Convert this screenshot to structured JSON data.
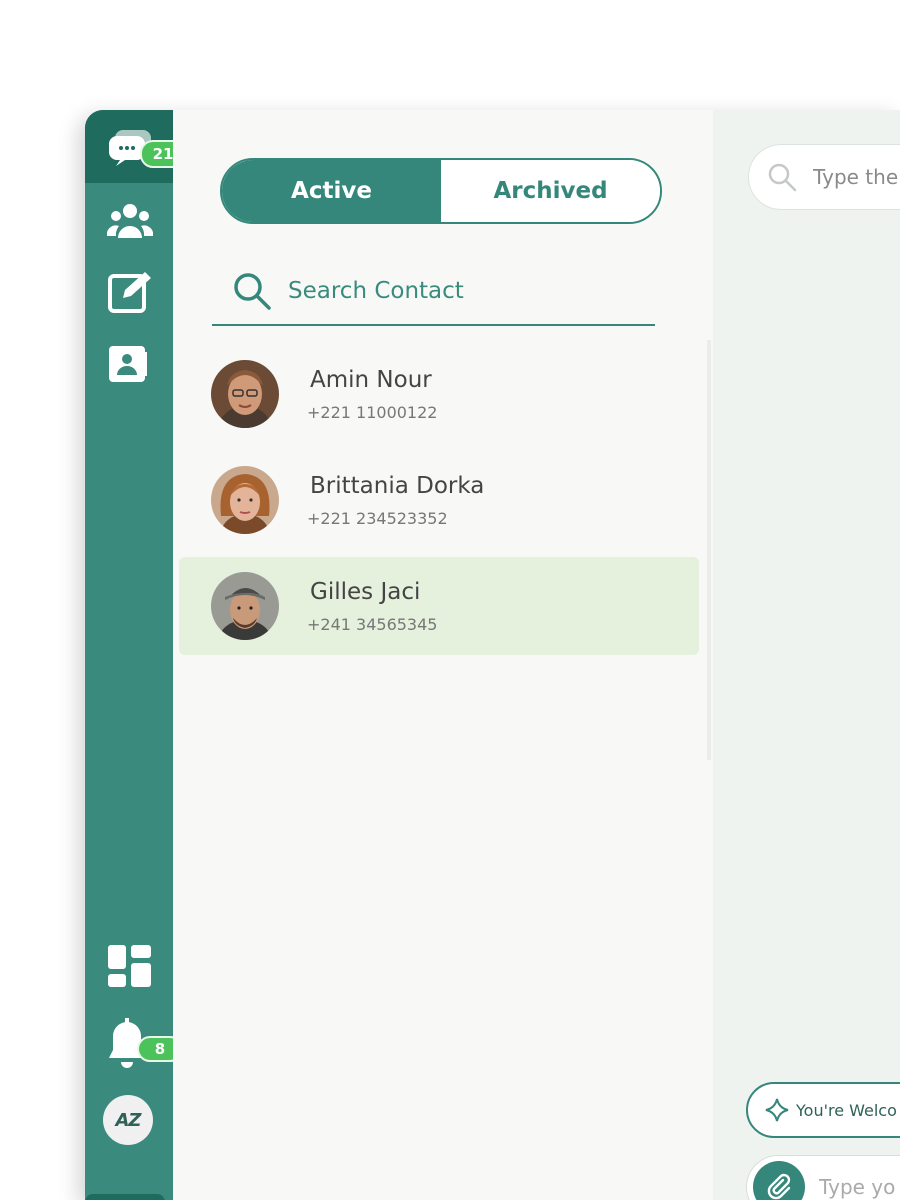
{
  "rail": {
    "chat_badge": "21",
    "notification_badge": "8",
    "logo_text": "AZ",
    "icons": [
      "chat-bubbles-icon",
      "group-users-icon",
      "edit-note-icon",
      "contact-book-icon",
      "dashboard-icon",
      "bell-icon"
    ]
  },
  "tabs": {
    "active_label": "Active",
    "archived_label": "Archived",
    "selected": "Active"
  },
  "contact_search": {
    "placeholder": "Search Contact"
  },
  "contacts": [
    {
      "name": "Amin Nour",
      "phone": "+221 11000122",
      "selected": false
    },
    {
      "name": "Brittania Dorka",
      "phone": "+221 234523352",
      "selected": false
    },
    {
      "name": "Gilles Jaci",
      "phone": "+241 34565345",
      "selected": true
    }
  ],
  "chat": {
    "search_placeholder": "Type the",
    "suggestion_text": "You're Welco",
    "message_placeholder": "Type yo"
  },
  "colors": {
    "brand": "#3a8a7d",
    "brand_dark": "#1f6b5e",
    "badge": "#4cc35a",
    "selected_row": "#e5f0dd"
  }
}
